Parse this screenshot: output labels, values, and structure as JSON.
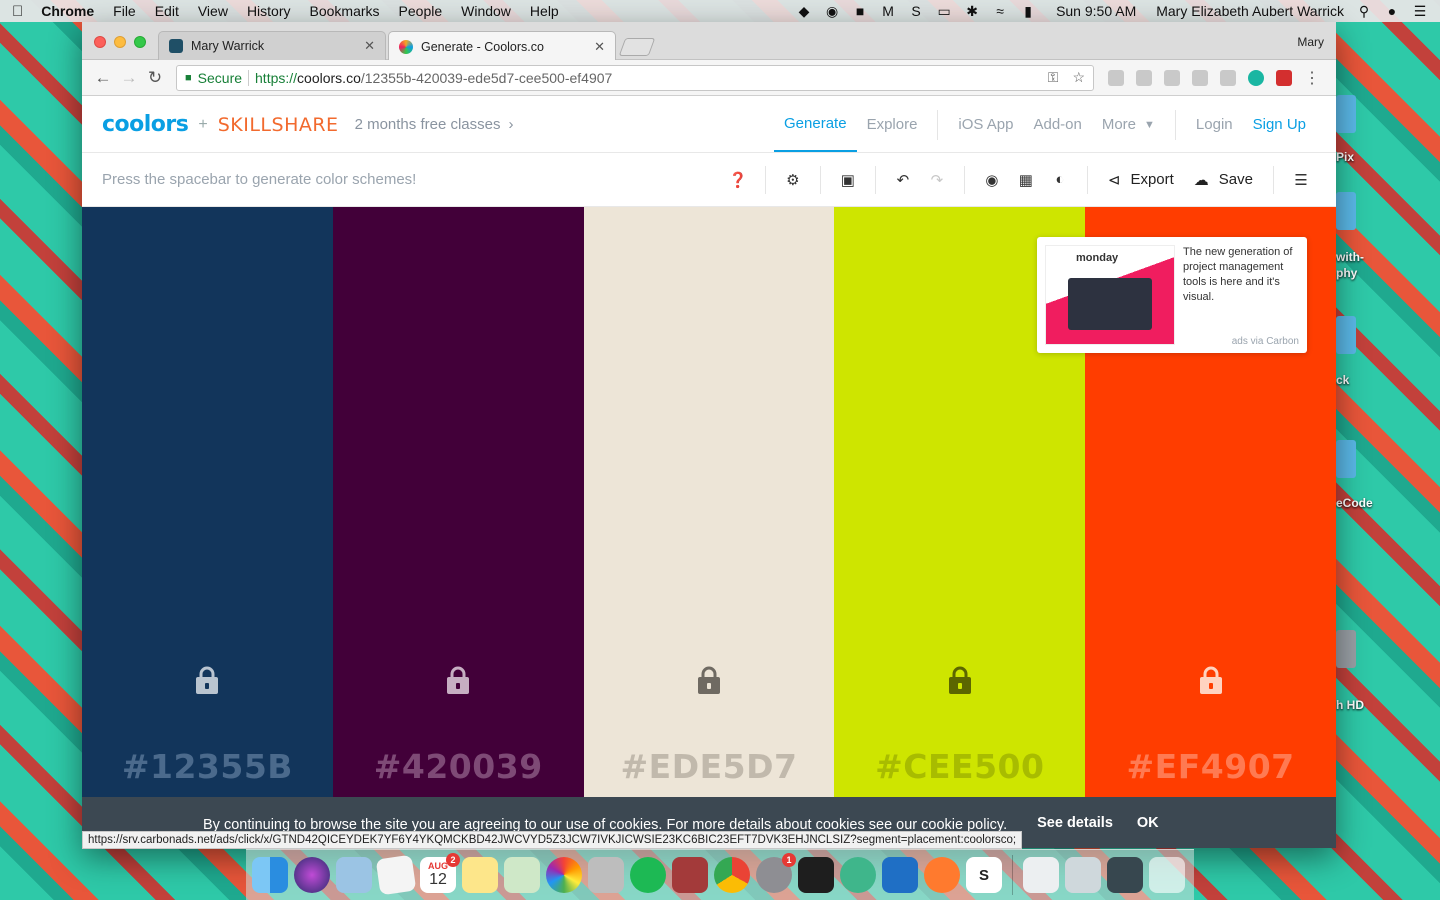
{
  "menubar": {
    "app": "Chrome",
    "items": [
      "File",
      "Edit",
      "View",
      "History",
      "Bookmarks",
      "People",
      "Window",
      "Help"
    ],
    "clock": "Sun 9:50 AM",
    "user": "Mary Elizabeth Aubert Warrick"
  },
  "desktop_labels": [
    "Pix",
    "with-",
    "phy",
    "ck",
    "eCode",
    "h HD"
  ],
  "browser": {
    "tabs": [
      {
        "title": "Mary Warrick",
        "active": false
      },
      {
        "title": "Generate - Coolors.co",
        "active": true
      }
    ],
    "profile": "Mary",
    "secure_label": "Secure",
    "url_proto": "https://",
    "url_host": "coolors.co",
    "url_path": "/12355b-420039-ede5d7-cee500-ef4907"
  },
  "site": {
    "logo": "coolors",
    "plus": "+",
    "partner": "SKILLSHARE",
    "promo": "2 months free classes",
    "nav": {
      "generate": "Generate",
      "explore": "Explore",
      "ios": "iOS App",
      "addon": "Add-on",
      "more": "More",
      "login": "Login",
      "signup": "Sign Up"
    }
  },
  "generator": {
    "hint": "Press the spacebar to generate color schemes!",
    "export_label": "Export",
    "save_label": "Save"
  },
  "palette": [
    {
      "hex": "#12355B",
      "color": "#12355b",
      "text_color": "#4b6a8c",
      "lock_color": "#b9c4d0"
    },
    {
      "hex": "#420039",
      "color": "#420039",
      "text_color": "#7e4a76",
      "lock_color": "#c6aec2"
    },
    {
      "hex": "#EDE5D7",
      "color": "#ede5d7",
      "text_color": "#c1b9ac",
      "lock_color": "#6f6a62"
    },
    {
      "hex": "#CEE500",
      "color": "#cee500",
      "text_color": "#a8bc00",
      "lock_color": "#5b6600"
    },
    {
      "hex": "#EF4907",
      "color": "#ff3d00",
      "text_color": "#ff7a52",
      "lock_color": "#ffd3c0"
    }
  ],
  "ad": {
    "brand": "monday",
    "text": "The new generation of project management tools is here and it's visual.",
    "via": "ads via Carbon"
  },
  "cookie": {
    "message": "By continuing to browse the site you are agreeing to our use of cookies. For more details about cookies see our cookie policy.",
    "details": "See details",
    "ok": "OK"
  },
  "status_url": "https://srv.carbonads.net/ads/click/x/GTND42QICEYDEK7YF6Y4YKQMCKBD42JWCVYD5Z3JCW7IVKJICWSIE23KC6BIC23EFT7DVK3EHJNCLSIZ?segment=placement:coolorsco;",
  "dock": {
    "calendar_month": "AUG",
    "calendar_day": "12",
    "calendar_badge": "2",
    "prefs_badge": "1"
  }
}
